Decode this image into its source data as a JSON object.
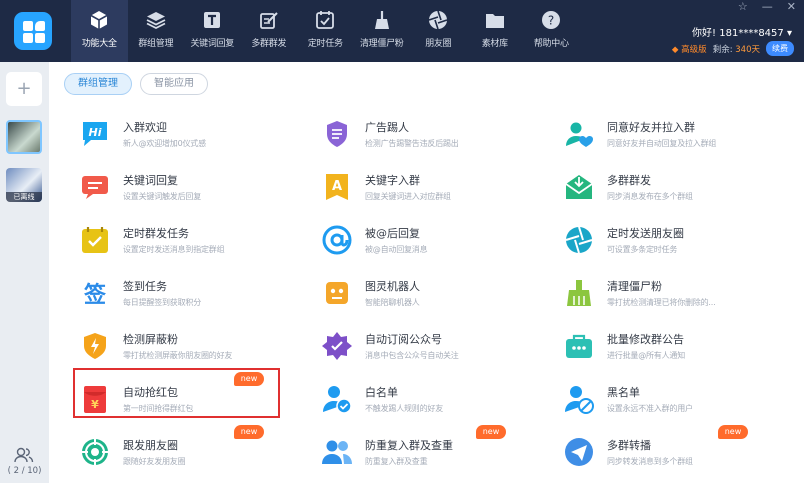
{
  "nav": {
    "items": [
      {
        "label": "功能大全",
        "icon": "cube-icon",
        "active": true
      },
      {
        "label": "群组管理",
        "icon": "layers-icon",
        "active": false
      },
      {
        "label": "关键词回复",
        "icon": "keyword-t-icon",
        "active": false
      },
      {
        "label": "多群群发",
        "icon": "edit-icon",
        "active": false
      },
      {
        "label": "定时任务",
        "icon": "calendar-check-icon",
        "active": false
      },
      {
        "label": "清理僵尸粉",
        "icon": "broom-icon",
        "active": false
      },
      {
        "label": "朋友圈",
        "icon": "aperture-icon",
        "active": false
      },
      {
        "label": "素材库",
        "icon": "folder-icon",
        "active": false
      },
      {
        "label": "帮助中心",
        "icon": "help-icon",
        "active": false
      }
    ]
  },
  "window": {
    "pin": "☆",
    "minimize": "—",
    "close": "✕"
  },
  "user": {
    "greeting": "你好! 181****8457",
    "dropdown": "▾",
    "vip": "高级版",
    "remain_label": "剩余: ",
    "remain_days": "340天",
    "renew": "续费"
  },
  "sidebar": {
    "add": "+",
    "offline": "已离线",
    "count": "( 2 / 10)"
  },
  "tabs": [
    {
      "label": "群组管理",
      "active": true
    },
    {
      "label": "智能应用",
      "active": false
    }
  ],
  "badge_text": "new",
  "features": [
    {
      "title": "入群欢迎",
      "desc": "新人@欢迎增加0仪式感",
      "icon": "hi-bubble-icon",
      "color": "#1aa6f0"
    },
    {
      "title": "广告踢人",
      "desc": "检测广告踢警告违反后踢出",
      "icon": "shield-list-icon",
      "color": "#8a64d6"
    },
    {
      "title": "同意好友并拉入群",
      "desc": "同意好友并自动回复及拉入群组",
      "icon": "user-heart-icon",
      "color": "#18b5a6"
    },
    {
      "title": "关键词回复",
      "desc": "设置关键词触发后回复",
      "icon": "chat-lines-icon",
      "color": "#f15a4a"
    },
    {
      "title": "关键字入群",
      "desc": "回复关键词进入对应群组",
      "icon": "badge-a-icon",
      "color": "#f2b31d"
    },
    {
      "title": "多群群发",
      "desc": "同步消息发布在多个群组",
      "icon": "mail-open-icon",
      "color": "#25b67f"
    },
    {
      "title": "定时群发任务",
      "desc": "设置定时发送消息到指定群组",
      "icon": "calendar-check-icon",
      "color": "#e7c315"
    },
    {
      "title": "被@后回复",
      "desc": "被@自动回复消息",
      "icon": "at-sign-icon",
      "color": "#1e9bf0"
    },
    {
      "title": "定时发送朋友圈",
      "desc": "可设置多条定时任务",
      "icon": "aperture-icon",
      "color": "#1aa6c8"
    },
    {
      "title": "签到任务",
      "desc": "每日提醒签到获取积分",
      "icon": "sign-char-icon",
      "color": "#2b8be8"
    },
    {
      "title": "图灵机器人",
      "desc": "智能陪聊机器人",
      "icon": "robot-icon",
      "color": "#f4a62a"
    },
    {
      "title": "清理僵尸粉",
      "desc": "零打扰检测清理已将你删除的...",
      "icon": "broom-icon",
      "color": "#8cc63f"
    },
    {
      "title": "检测屏蔽粉",
      "desc": "零打扰检测屏蔽你朋友圈的好友",
      "icon": "shield-lightning-icon",
      "color": "#f5a31a"
    },
    {
      "title": "自动订阅公众号",
      "desc": "消息中包含公众号自动关注",
      "icon": "star-badge-icon",
      "color": "#7d4fc8"
    },
    {
      "title": "批量修改群公告",
      "desc": "进行批量@所有人通知",
      "icon": "bag-icon",
      "color": "#2cc0b4"
    },
    {
      "title": "自动抢红包",
      "desc": "第一时间抢得群红包",
      "icon": "red-packet-icon",
      "color": "#ee3b3b",
      "badge": true
    },
    {
      "title": "白名单",
      "desc": "不触发踢人规则的好友",
      "icon": "user-check-icon",
      "color": "#1e9bf0"
    },
    {
      "title": "黑名单",
      "desc": "设置永远不准入群的用户",
      "icon": "user-block-icon",
      "color": "#1e9bf0"
    },
    {
      "title": "跟发朋友圈",
      "desc": "跟随好友发朋友圈",
      "icon": "target-icon",
      "color": "#1eb48a",
      "badge": true
    },
    {
      "title": "防重复入群及查重",
      "desc": "防重复入群及查重",
      "icon": "users-icon",
      "color": "#2f8fe8",
      "badge": true
    },
    {
      "title": "多群转播",
      "desc": "同步转发消息到多个群组",
      "icon": "send-icon",
      "color": "#3f8ee6",
      "badge": true
    }
  ]
}
